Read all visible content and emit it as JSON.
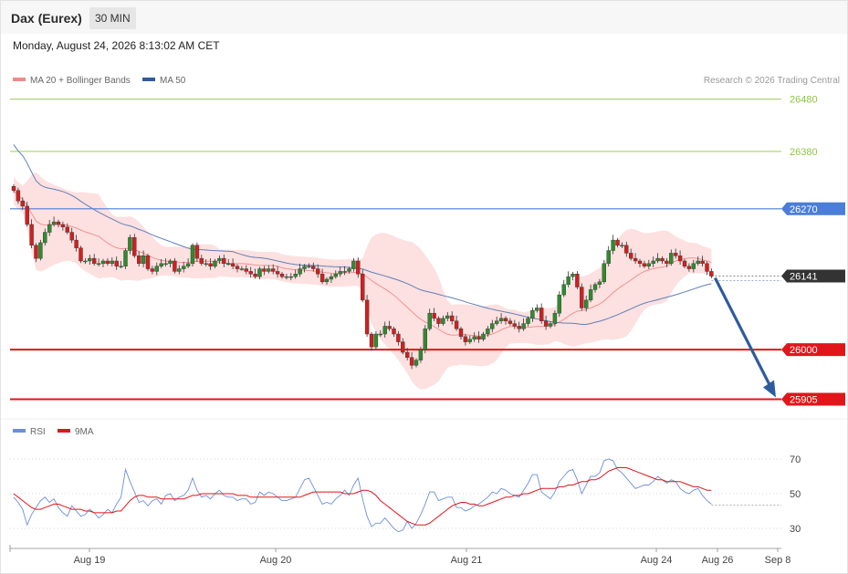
{
  "header": {
    "title": "Dax (Eurex)",
    "interval": "30 MIN",
    "datetime": "Monday, August 24, 2026 8:13:02 AM CET"
  },
  "legend": {
    "bands": "MA 20 + Bollinger Bands",
    "ma50": "MA 50",
    "copyright": "Research © 2026 Trading Central",
    "rsi": "RSI",
    "rsi_ma": "9MA"
  },
  "colors": {
    "bull": "#2e8b2e",
    "bear": "#d11f1f",
    "band": "#fde0e0",
    "ma20": "#f08a8a",
    "ma50": "#5f80b8",
    "resistance": "#8cc63f",
    "pivot": "#4a7ed8",
    "support": "#e0161b",
    "last": "#333333",
    "arrow": "#2f5b9e",
    "rsi": "#6b8fd9",
    "rsi_ma": "#e0161b"
  },
  "chart_data": [
    {
      "type": "candlestick",
      "title": "Dax (Eurex)",
      "interval": "30 MIN",
      "ylim": [
        25890,
        26510
      ],
      "levels": [
        {
          "value": 26480,
          "label": "26480",
          "kind": "resistance"
        },
        {
          "value": 26380,
          "label": "26380",
          "kind": "resistance"
        },
        {
          "value": 26270,
          "label": "26270",
          "kind": "pivot"
        },
        {
          "value": 26141,
          "label": "26141",
          "kind": "last"
        },
        {
          "value": 26000,
          "label": "26000",
          "kind": "support"
        },
        {
          "value": 25905,
          "label": "25905",
          "kind": "support"
        }
      ],
      "x_labels": [
        "Aug 19",
        "Aug 20",
        "Aug 21",
        "Aug 24",
        "Aug 26",
        "Sep 8"
      ],
      "forecast": {
        "from": 26141,
        "to": 25905
      },
      "series": [
        {
          "name": "MA 20 + Bollinger Bands",
          "kind": "ma20"
        },
        {
          "name": "MA 50",
          "kind": "ma50"
        }
      ],
      "closes": [
        26305,
        26285,
        26275,
        26240,
        26200,
        26175,
        26205,
        26225,
        26240,
        26245,
        26240,
        26235,
        26225,
        26210,
        26195,
        26170,
        26170,
        26175,
        26165,
        26165,
        26170,
        26165,
        26170,
        26160,
        26160,
        26190,
        26215,
        26180,
        26165,
        26180,
        26155,
        26150,
        26160,
        26165,
        26165,
        26170,
        26150,
        26155,
        26160,
        26165,
        26200,
        26175,
        26165,
        26165,
        26160,
        26170,
        26175,
        26165,
        26165,
        26160,
        26155,
        26155,
        26150,
        26145,
        26140,
        26155,
        26150,
        26155,
        26150,
        26145,
        26140,
        26140,
        26140,
        26145,
        26155,
        26160,
        26160,
        26155,
        26145,
        26130,
        26135,
        26140,
        26145,
        26150,
        26150,
        26155,
        26170,
        26145,
        26095,
        26030,
        26005,
        26030,
        26030,
        26045,
        26040,
        26030,
        26015,
        25995,
        25985,
        25970,
        25980,
        26000,
        26040,
        26070,
        26060,
        26050,
        26060,
        26065,
        26055,
        26040,
        26025,
        26015,
        26020,
        26025,
        26020,
        26030,
        26040,
        26050,
        26055,
        26060,
        26055,
        26050,
        26045,
        26040,
        26050,
        26060,
        26075,
        26080,
        26055,
        26045,
        26050,
        26070,
        26105,
        26125,
        26140,
        26145,
        26120,
        26080,
        26095,
        26115,
        26125,
        26130,
        26165,
        26190,
        26210,
        26200,
        26200,
        26185,
        26175,
        26170,
        26165,
        26160,
        26165,
        26170,
        26175,
        26170,
        26165,
        26185,
        26180,
        26170,
        26160,
        26155,
        26165,
        26170,
        26165,
        26150,
        26141
      ],
      "rsi": {
        "ylim": [
          22,
          82
        ],
        "ticks": [
          70,
          50,
          30
        ],
        "values": [
          48,
          45,
          41,
          32,
          38,
          42,
          46,
          48,
          45,
          47,
          42,
          39,
          37,
          43,
          40,
          37,
          38,
          41,
          39,
          36,
          38,
          41,
          39,
          44,
          48,
          64,
          57,
          51,
          45,
          46,
          43,
          46,
          47,
          44,
          49,
          50,
          46,
          48,
          49,
          52,
          59,
          52,
          48,
          49,
          47,
          50,
          52,
          49,
          48,
          48,
          46,
          47,
          47,
          44,
          45,
          51,
          49,
          51,
          50,
          48,
          46,
          46,
          47,
          48,
          53,
          58,
          59,
          54,
          49,
          44,
          45,
          44,
          47,
          49,
          52,
          49,
          55,
          59,
          47,
          37,
          31,
          33,
          33,
          36,
          33,
          30,
          28,
          29,
          34,
          30,
          33,
          38,
          44,
          51,
          51,
          46,
          47,
          48,
          48,
          42,
          42,
          40,
          41,
          43,
          44,
          46,
          48,
          51,
          50,
          53,
          52,
          50,
          49,
          48,
          52,
          56,
          61,
          61,
          51,
          49,
          47,
          51,
          57,
          60,
          63,
          64,
          58,
          50,
          55,
          60,
          60,
          62,
          69,
          70,
          69,
          64,
          62,
          59,
          56,
          53,
          54,
          55,
          55,
          57,
          60,
          58,
          56,
          58,
          57,
          53,
          51,
          50,
          52,
          53,
          49,
          46,
          44
        ],
        "ma_values": [
          50,
          48,
          46,
          44,
          42,
          41,
          41,
          42,
          43,
          44,
          44,
          43,
          42,
          41,
          41,
          41,
          40,
          40,
          39,
          39,
          39,
          39,
          39,
          40,
          40,
          43,
          46,
          48,
          49,
          49,
          48,
          48,
          48,
          47,
          47,
          47,
          47,
          47,
          47,
          48,
          49,
          49,
          50,
          50,
          50,
          50,
          50,
          50,
          50,
          50,
          49,
          49,
          49,
          48,
          48,
          48,
          48,
          48,
          48,
          48,
          48,
          48,
          48,
          48,
          48,
          49,
          50,
          51,
          51,
          51,
          51,
          51,
          51,
          51,
          50,
          50,
          50,
          51,
          52,
          52,
          51,
          49,
          46,
          44,
          42,
          40,
          38,
          36,
          34,
          33,
          32,
          32,
          32,
          33,
          35,
          37,
          39,
          41,
          43,
          44,
          45,
          45,
          44,
          44,
          43,
          43,
          44,
          45,
          46,
          47,
          48,
          48,
          49,
          49,
          50,
          50,
          51,
          52,
          53,
          53,
          53,
          53,
          54,
          54,
          55,
          55,
          56,
          57,
          57,
          58,
          58,
          59,
          61,
          63,
          64,
          65,
          65,
          65,
          64,
          63,
          62,
          61,
          60,
          59,
          58,
          58,
          57,
          57,
          57,
          57,
          56,
          55,
          54,
          54,
          53,
          52,
          52
        ]
      }
    }
  ]
}
